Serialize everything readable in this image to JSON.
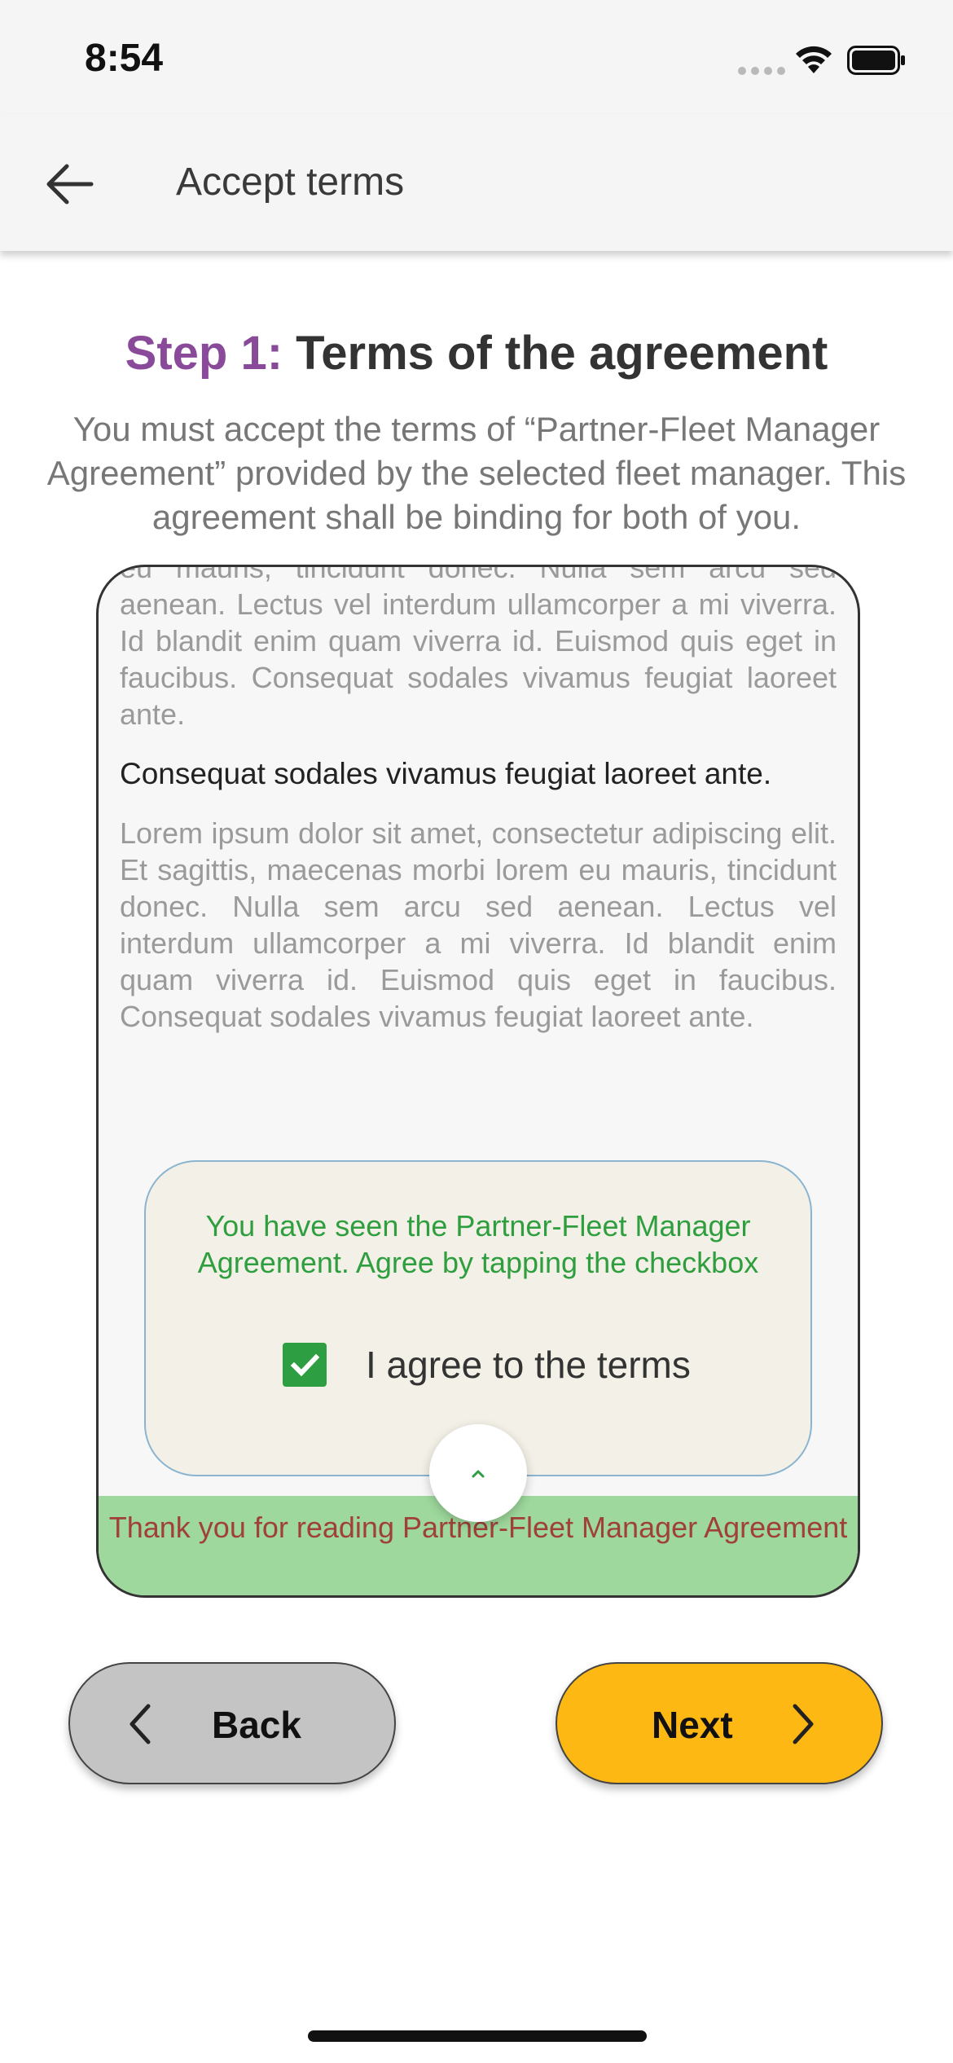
{
  "status_bar": {
    "time": "8:54"
  },
  "app_bar": {
    "title": "Accept terms"
  },
  "step": {
    "prefix": "Step 1:",
    "title": "Terms of the agreement",
    "description": "You must accept the terms of “Partner-Fleet Manager Agreement” provided by the selected fleet manager. This agreement shall be binding for both of you."
  },
  "terms": {
    "paragraph_partial": "eu mauris, tincidunt donec. Nulla sem arcu sed aenean. Lectus vel interdum ullamcorper a mi viverra. Id blandit enim quam viverra id. Euismod quis eget in faucibus. Consequat sodales vivamus feugiat laoreet ante.",
    "heading": "Consequat sodales vivamus feugiat laoreet ante.",
    "paragraph": "Lorem ipsum dolor sit amet, consectetur adipiscing elit. Et sagittis, maecenas morbi lorem eu mauris, tincidunt donec. Nulla sem arcu sed aenean. Lectus vel interdum ullamcorper a mi viverra. Id blandit enim quam viverra id. Euismod quis eget in faucibus. Consequat sodales vivamus feugiat laoreet ante."
  },
  "agreement": {
    "message": "You have seen the Partner-Fleet Manager Agreement. Agree by tapping the checkbox",
    "checkbox_label": "I agree to the terms",
    "checked": true
  },
  "thanks_banner": "Thank you for reading Partner-Fleet Manager Agreement",
  "buttons": {
    "back": "Back",
    "next": "Next"
  },
  "colors": {
    "step_prefix": "#8a4a9a",
    "agree_text": "#2f9e3f",
    "checkbox": "#2e9e42",
    "banner_bg": "#9ed89c",
    "banner_text": "#a0403a",
    "next_bg": "#fdb813",
    "back_bg": "#c4c4c4"
  }
}
